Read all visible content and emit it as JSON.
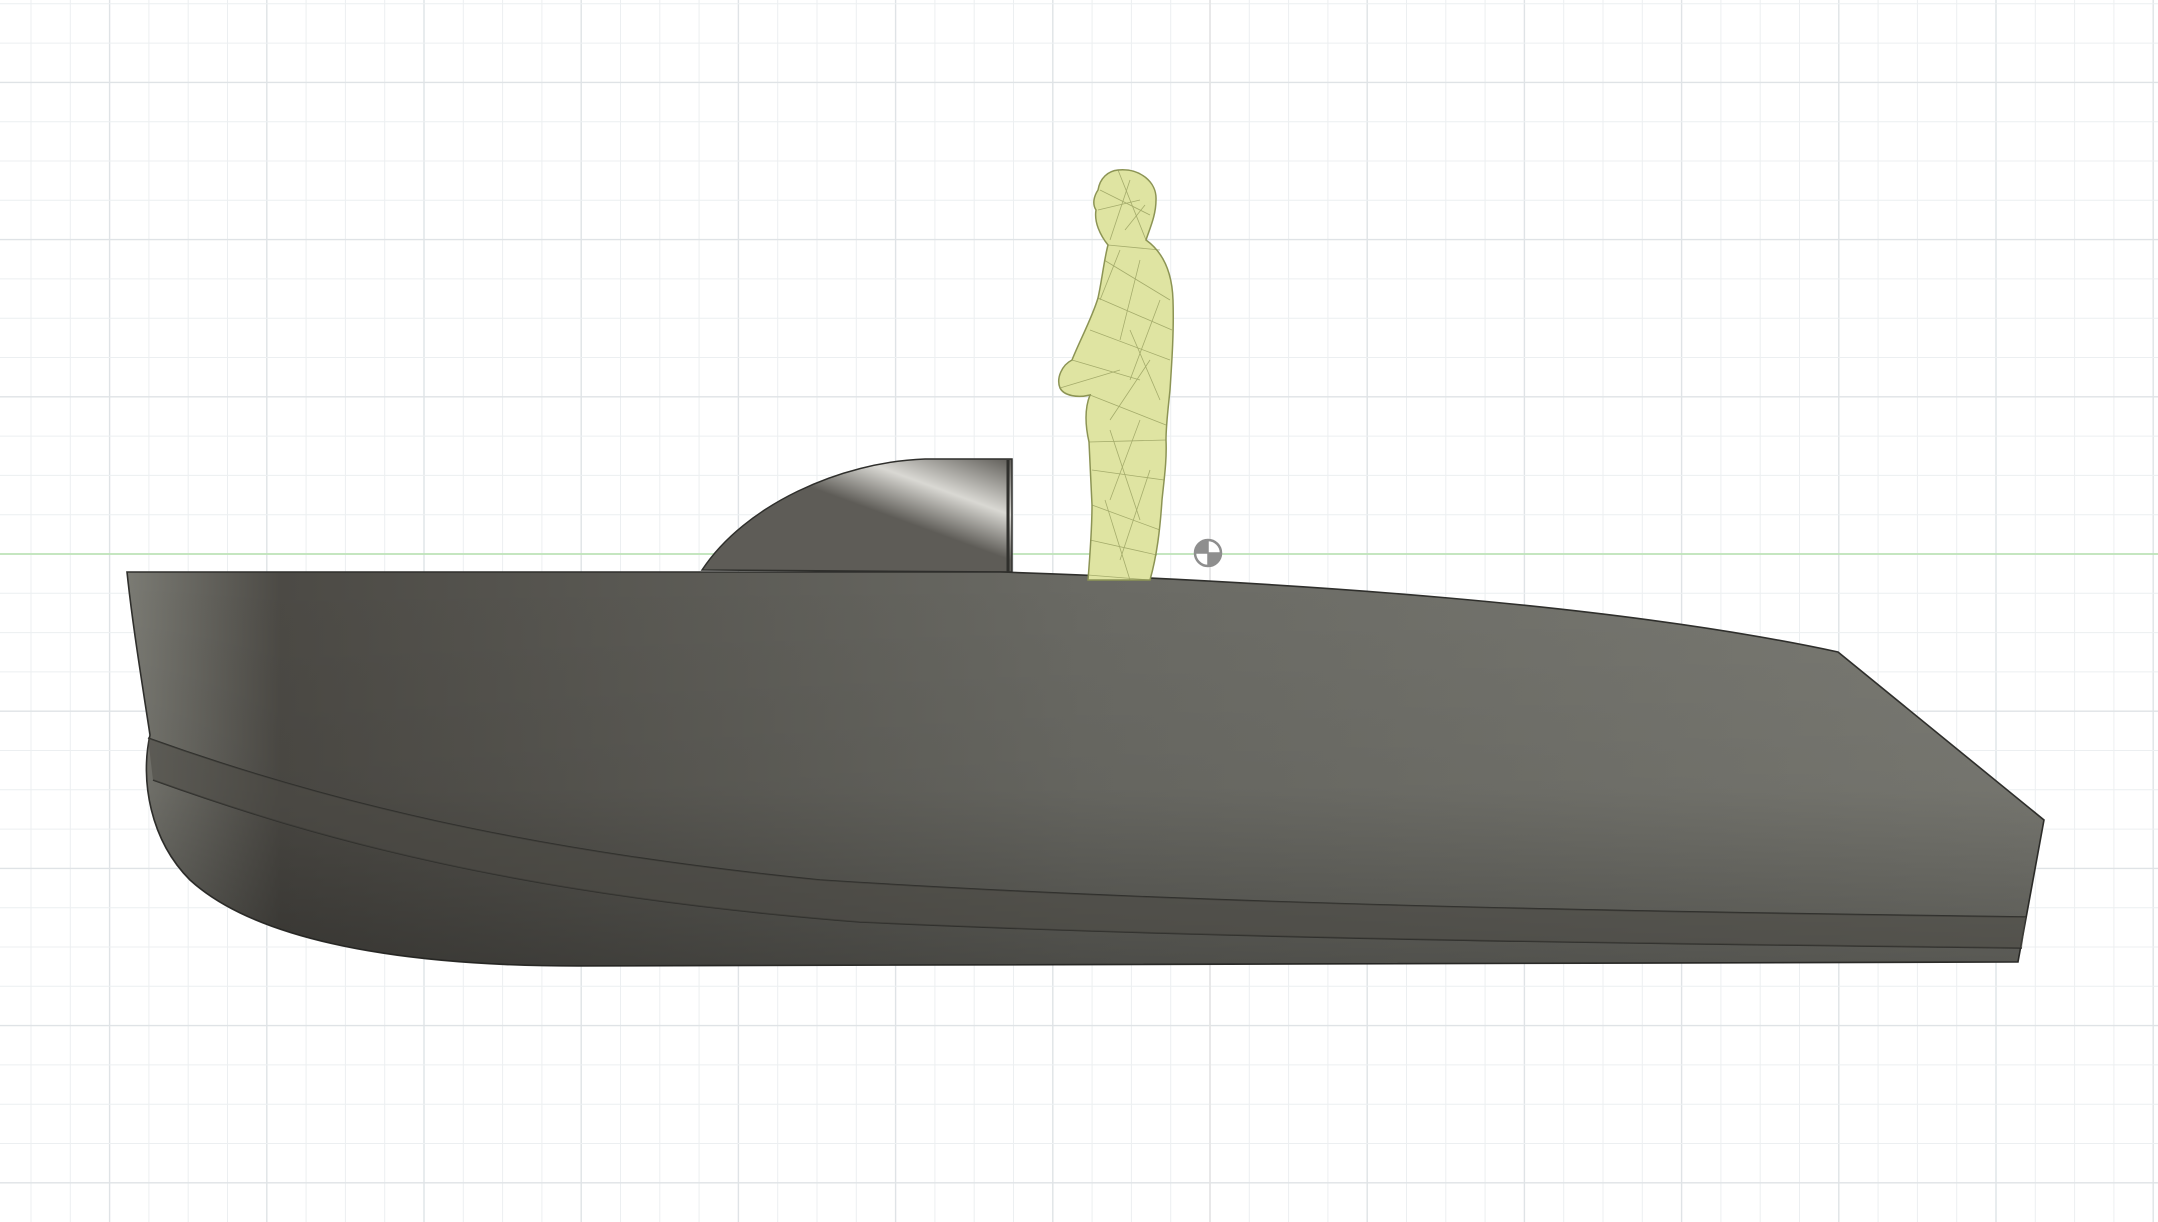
{
  "app": {
    "view": "side-elevation",
    "background_color": "#ffffff"
  },
  "canvas": {
    "grid": true,
    "grid_minor_color": "#eceff1",
    "grid_major_color": "#dfe3e6",
    "horizon_axis_color": "#b7e3b0",
    "vertical_axis_color": "#e4e4e4"
  },
  "model": {
    "hull": {
      "name": "boat-hull",
      "color_light": "#7b7b74",
      "color_mid": "#6a6a64",
      "color_dark": "#4c4a45",
      "outline_color": "#2f2f2c"
    },
    "windshield": {
      "name": "windshield-canopy",
      "color_light": "#d9d8d3",
      "color_dark": "#5e5c57"
    },
    "figure": {
      "name": "standing-person",
      "color": "#dfe4a2",
      "edge_color": "#8c9454"
    }
  },
  "origin_marker": {
    "icon": "origin-pivot-icon",
    "color": "#8e8e8e"
  }
}
